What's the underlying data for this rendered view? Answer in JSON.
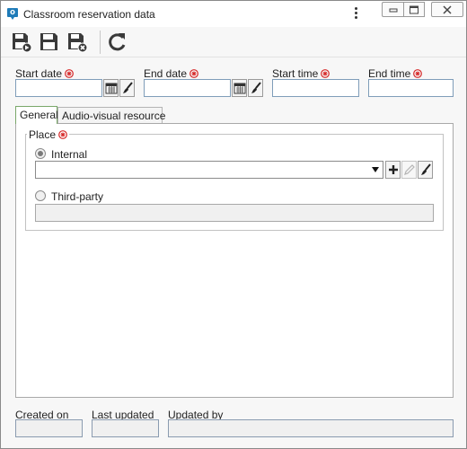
{
  "window": {
    "title": "Classroom reservation data",
    "icon": "app-icon"
  },
  "toolbar": {
    "buttons": [
      {
        "name": "save-and-new-button",
        "icon": "save-new-icon"
      },
      {
        "name": "save-button",
        "icon": "save-icon"
      },
      {
        "name": "save-and-close-button",
        "icon": "save-close-icon"
      },
      {
        "name": "refresh-button",
        "icon": "refresh-icon"
      }
    ]
  },
  "fields": {
    "start_date": {
      "label": "Start date",
      "value": ""
    },
    "end_date": {
      "label": "End date",
      "value": ""
    },
    "start_time": {
      "label": "Start time",
      "value": ""
    },
    "end_time": {
      "label": "End time",
      "value": ""
    }
  },
  "tabs": [
    {
      "label": "General",
      "active": true
    },
    {
      "label": "Audio-visual resource",
      "active": false
    }
  ],
  "place": {
    "legend": "Place",
    "internal_label": "Internal",
    "internal_selected": true,
    "internal_value": "",
    "third_party_label": "Third-party",
    "third_party_value": ""
  },
  "footer": {
    "created_on": {
      "label": "Created on",
      "value": ""
    },
    "last_updated": {
      "label": "Last updated",
      "value": ""
    },
    "updated_by": {
      "label": "Updated by",
      "value": ""
    }
  },
  "colors": {
    "required": "#d62828",
    "accent": "#1e7bb8",
    "tab_active_border": "#7aa86a"
  }
}
